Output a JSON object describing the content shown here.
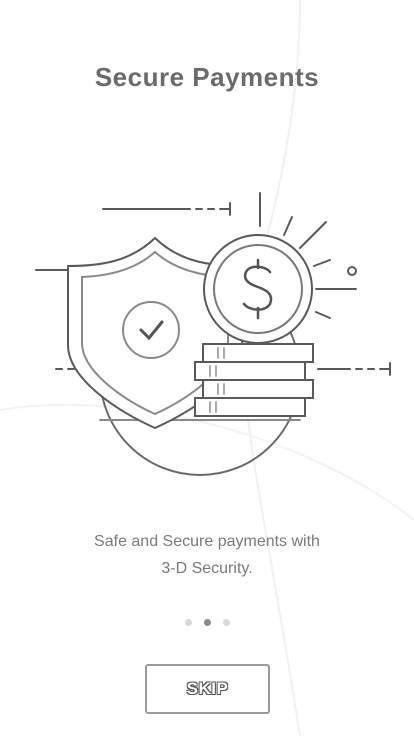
{
  "onboarding": {
    "title": "Secure Payments",
    "description_line1": "Safe and Secure payments with",
    "description_line2": "3-D Security.",
    "skip_label": "SKIP",
    "illustration_icons": [
      "shield-icon",
      "checkmark-icon",
      "dollar-coin-icon",
      "coin-stack-icon"
    ],
    "pagination": {
      "total": 3,
      "active": 2
    }
  },
  "colors": {
    "title": "#6b6b6b",
    "text": "#7a7a7a",
    "line": "#5a5a5a",
    "dot_active": "#8a8a8a",
    "dot_inactive": "#d9d9d9",
    "button_border": "#9a9a9a"
  }
}
